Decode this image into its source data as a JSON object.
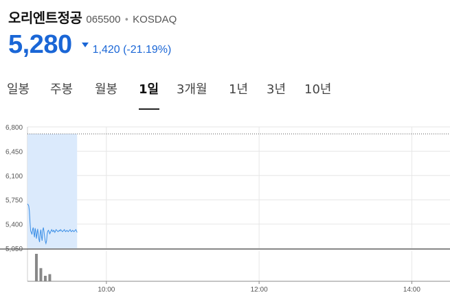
{
  "stock": {
    "name": "오리엔트정공",
    "code": "065500",
    "separator": "•",
    "market": "KOSDAQ",
    "price": "5,280",
    "change_direction": "down",
    "change": "1,420 (-21.19%)",
    "colors": {
      "down": "#1a66d6",
      "area_fill": "#dbeafc",
      "line": "#3a8ee6",
      "volume_bar": "#888888"
    }
  },
  "tabs": [
    {
      "label": "일봉",
      "active": false
    },
    {
      "label": "주봉",
      "active": false
    },
    {
      "label": "월봉",
      "active": false
    },
    {
      "label": "1일",
      "active": true
    },
    {
      "label": "3개월",
      "active": false
    },
    {
      "label": "1년",
      "active": false
    },
    {
      "label": "3년",
      "active": false
    },
    {
      "label": "10년",
      "active": false
    }
  ],
  "chart_data": {
    "type": "area",
    "y_ticks": [
      "6,800",
      "6,450",
      "6,100",
      "5,750",
      "5,400",
      "5,050"
    ],
    "ylim": [
      5050,
      6800
    ],
    "x_ticks": [
      "10:00",
      "12:00",
      "14:00"
    ],
    "x_tick_values": [
      600,
      720,
      840
    ],
    "xlim": [
      538,
      870
    ],
    "reference_line": 6700,
    "grid": true,
    "series": [
      {
        "x": [
          538,
          538.5,
          539,
          539.5,
          540,
          540.5,
          541,
          541.5,
          542,
          542.5,
          543,
          543.5,
          544,
          544.5,
          545,
          545.5,
          546,
          546.5,
          547,
          547.5,
          548,
          548.5,
          549,
          549.5,
          550,
          550.5,
          551,
          551.5,
          552,
          552.5,
          553,
          553.5,
          554,
          554.5,
          555,
          555.5,
          556,
          556.5,
          557,
          557.5,
          558,
          558.5,
          559,
          559.5,
          560,
          560.5,
          561,
          561.5,
          562,
          562.5,
          563,
          563.5,
          564,
          564.5,
          565,
          565.5,
          566,
          566.5,
          567,
          567.5,
          568,
          568.5,
          569,
          569.5,
          570,
          570.5,
          571,
          571.5,
          572,
          572.5,
          573,
          573.5,
          574,
          574.5,
          575,
          575.5,
          576,
          576.5,
          577
        ],
        "values": [
          5690,
          5680,
          5660,
          5590,
          5430,
          5300,
          5280,
          5250,
          5320,
          5350,
          5270,
          5210,
          5340,
          5300,
          5190,
          5260,
          5330,
          5250,
          5180,
          5140,
          5270,
          5320,
          5220,
          5160,
          5310,
          5350,
          5290,
          5210,
          5150,
          5120,
          5160,
          5260,
          5300,
          5310,
          5290,
          5260,
          5280,
          5300,
          5320,
          5300,
          5290,
          5310,
          5300,
          5280,
          5300,
          5320,
          5310,
          5300,
          5290,
          5300,
          5310,
          5300,
          5320,
          5310,
          5300,
          5290,
          5300,
          5310,
          5320,
          5300,
          5290,
          5300,
          5310,
          5300,
          5290,
          5300,
          5310,
          5320,
          5300,
          5290,
          5300,
          5310,
          5300,
          5290,
          5300,
          5310,
          5320,
          5300,
          5280
        ]
      }
    ],
    "volume": {
      "x": [
        545,
        548.5,
        552,
        555.5
      ],
      "values": [
        100,
        48,
        20,
        26
      ]
    }
  }
}
